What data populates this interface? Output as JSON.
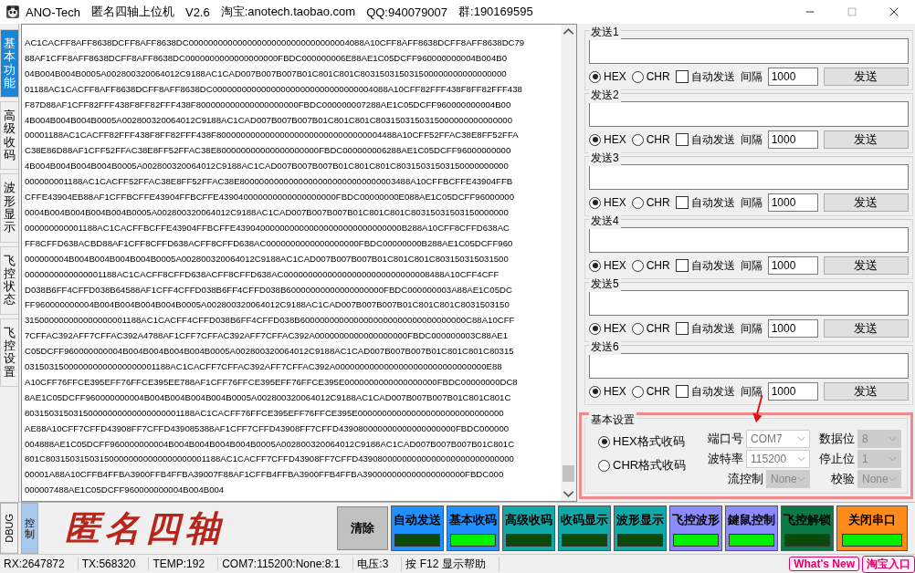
{
  "window": {
    "title_parts": [
      "ANO-Tech",
      "匿名四轴上位机",
      "V2.6",
      "淘宝:anotech.taobao.com",
      "QQ:940079007",
      "群:190169595"
    ]
  },
  "side_tabs": [
    {
      "label": "基本功能",
      "selected": true
    },
    {
      "label": "高级收码",
      "selected": false
    },
    {
      "label": "波形显示",
      "selected": false
    },
    {
      "label": "飞控状态",
      "selected": false
    },
    {
      "label": "飞控设置",
      "selected": false
    }
  ],
  "receive_log": {
    "lines": [
      "AC1CACFF8AFF8638DCFF8AFF8638DC000000000000000000000000000000004088A10CFF8AFF8638DCFF8AFF8638DC79",
      "88AF1CFF8AFF8638DCFF8AFF8638DC0000000000000000000FBDC000000006E88AE1C05DCFF960000000004B004B0",
      "04B004B004B0005A002800320064012C9188AC1CAD007B007B007B01C801C801C803150315031500000000000000000",
      "01188AC1CACFF8AFF8638DCFF8AFF8638DC000000000000000000000000000000004088A10CFF82FFF438F8FF82FFF438",
      "F87D88AF1CFF82FFF438F8FF82FFF438F800000000000000000000FBDC000000007288AE1C05DCFF960000000004B00",
      "4B004B004B004B0005A002800320064012C9188AC1CAD007B007B007B01C801C801C8031503150315000000000000000",
      "00001188AC1CACFF82FFF438F8FF82FFF438F8000000000000000000000000000000004488A10CFF52FFAC38E8FF52FFA",
      "C38E86D88AF1CFF52FFAC38E8FF52FFAC38E800000000000000000000FBDC000000006288AE1C05DCFF96000000000",
      "4B004B004B004B004B0005A002800320064012C9188AC1CAD007B007B007B01C801C801C80315031503150000000000",
      "000000001188AC1CACFF52FFAC38E8FF52FFAC38E80000000000000000000000000000003488A10CFFBCFFE43904FFB",
      "CFFE43904EB88AF1CFFBCFFE43904FFBCFFE439040000000000000000000FBDC00000000E088AE1C05DCFF96000000",
      "0004B004B004B004B004B0005A002800320064012C9188AC1CAD007B007B007B01C801C801C80315031503150000000",
      "000000000001188AC1CACFFBCFFE43904FFBCFFE4390400000000000000000000000000000B288A10CFF8CFFD638AC",
      "FF8CFFD638ACBD88AF1CFF8CFFD638ACFF8CFFD638AC0000000000000000000FBDC00000000B288AE1C05DCFF960",
      "000000004B004B004B004B004B0005A002800320064012C9188AC1CAD007B007B007B01C801C801C803150315031500",
      "0000000000000001188AC1CACFF8CFFD638ACFF8CFFD638AC000000000000000000000000000008488A10CFF4CFF",
      "D038B6FF4CFFD038B64588AF1CFF4CFFD038B6FF4CFFD038B60000000000000000000FBDC000000003A88AE1C05DC",
      "FF960000000004B004B004B004B004B0005A002800320064012C9188AC1CAD007B007B007B01C801C801C8031503150",
      "315000000000000000001188AC1CACFF4CFFD038B6FF4CFFD038B6000000000000000000000000000000000C88A10CFF",
      "7CFFAC392AFF7CFFAC392A4788AF1CFF7CFFAC392AFF7CFFAC392A0000000000000000000FBDC000000003C88AE1",
      "C05DCFF960000000004B004B004B004B004B0005A002800320064012C9188AC1CAD007B007B007B01C801C801C80315",
      "031503150000000000000000001188AC1CACFF7CFFAC392AFF7CFFAC392A0000000000000000000000000000000E88",
      "A10CFF76FFCE395EFF76FFCE395EE788AF1CFF76FFCE395EFF76FFCE395E0000000000000000000FBDC00000000DC8",
      "8AE1C05DCFF960000000004B004B004B004B004B0005A002800320064012C9188AC1CAD007B007B007B01C801C801C",
      "80315031503150000000000000000001188AC1CACFF76FFCE395EFF76FFCE395E000000000000000000000000000000",
      "AE88A10CFF7CFFD43908FF7CFFD439085388AF1CFF7CFFD43908FF7CFFD439080000000000000000000FBDC000000",
      "004888AE1C05DCFF960000000004B004B004B004B004B0005A002800320064012C9188AC1CAD007B007B007B01C801C",
      "801C803150315031500000000000000000001188AC1CACFF7CFFD43908FF7CFFD43908000000000000000000000000000",
      "00001A88A10CFFB4FFBA3900FFB4FFBA39007F88AF1CFFB4FFBA3900FFB4FFBA390000000000000000000FBDC000",
      "000007488AE1C05DCFF960000000004B004B004"
    ]
  },
  "send_groups": [
    {
      "title": "发送1",
      "hex_label": "HEX",
      "hex_selected": true,
      "chr_label": "CHR",
      "chr_selected": false,
      "auto_label": "自动发送",
      "auto_checked": false,
      "interval_label": "间隔",
      "interval": "1000",
      "button": "发送"
    },
    {
      "title": "发送2",
      "hex_label": "HEX",
      "hex_selected": true,
      "chr_label": "CHR",
      "chr_selected": false,
      "auto_label": "自动发送",
      "auto_checked": false,
      "interval_label": "间隔",
      "interval": "1000",
      "button": "发送"
    },
    {
      "title": "发送3",
      "hex_label": "HEX",
      "hex_selected": true,
      "chr_label": "CHR",
      "chr_selected": false,
      "auto_label": "自动发送",
      "auto_checked": false,
      "interval_label": "间隔",
      "interval": "1000",
      "button": "发送"
    },
    {
      "title": "发送4",
      "hex_label": "HEX",
      "hex_selected": true,
      "chr_label": "CHR",
      "chr_selected": false,
      "auto_label": "自动发送",
      "auto_checked": false,
      "interval_label": "间隔",
      "interval": "1000",
      "button": "发送"
    },
    {
      "title": "发送5",
      "hex_label": "HEX",
      "hex_selected": true,
      "chr_label": "CHR",
      "chr_selected": false,
      "auto_label": "自动发送",
      "auto_checked": false,
      "interval_label": "间隔",
      "interval": "1000",
      "button": "发送"
    },
    {
      "title": "发送6",
      "hex_label": "HEX",
      "hex_selected": true,
      "chr_label": "CHR",
      "chr_selected": false,
      "auto_label": "自动发送",
      "auto_checked": false,
      "interval_label": "间隔",
      "interval": "1000",
      "button": "发送"
    }
  ],
  "settings": {
    "title": "基本设置",
    "formats": [
      {
        "label": "HEX格式收码",
        "selected": true
      },
      {
        "label": "CHR格式收码",
        "selected": false
      }
    ],
    "fields": [
      {
        "label": "端口号",
        "value": "COM7",
        "disabled": false
      },
      {
        "label": "数据位",
        "value": "8",
        "disabled": true
      },
      {
        "label": "波特率",
        "value": "115200",
        "disabled": false
      },
      {
        "label": "停止位",
        "value": "1",
        "disabled": true
      },
      {
        "label": "流控制",
        "value": "None",
        "disabled": true
      },
      {
        "label": "校验",
        "value": "None",
        "disabled": true
      }
    ]
  },
  "bottom_tabs": [
    {
      "label": "DBUG",
      "selected": false,
      "kind": "latin"
    },
    {
      "label": "控制",
      "selected": true,
      "kind": "cjk"
    }
  ],
  "logo": "匿名四轴",
  "clear_button": "清除",
  "toggle_buttons": [
    {
      "label": "自动发送",
      "color": "#1e90ff",
      "on": false
    },
    {
      "label": "基本收码",
      "color": "#1e90ff",
      "on": true
    },
    {
      "label": "高级收码",
      "color": "#11a8a8",
      "on": false
    },
    {
      "label": "收码显示",
      "color": "#11a8a8",
      "on": false
    },
    {
      "label": "波形显示",
      "color": "#11a8a8",
      "on": false
    },
    {
      "label": "飞控波形",
      "color": "#8c8cff",
      "on": true
    },
    {
      "label": "鍵鼠控制",
      "color": "#8c8cff",
      "on": true
    },
    {
      "label": "飞控解锁",
      "color": "#0c7a46",
      "on": false
    },
    {
      "label": "关闭串口",
      "color": "#ff8c1a",
      "on": true
    }
  ],
  "status_bar": [
    "RX:2647872",
    "TX:568320",
    "TEMP:192",
    "COM7:115200:None:8:1",
    "电压:3",
    "按 F12 显示帮助"
  ],
  "status_links": [
    "What's New",
    "淘宝入口"
  ]
}
